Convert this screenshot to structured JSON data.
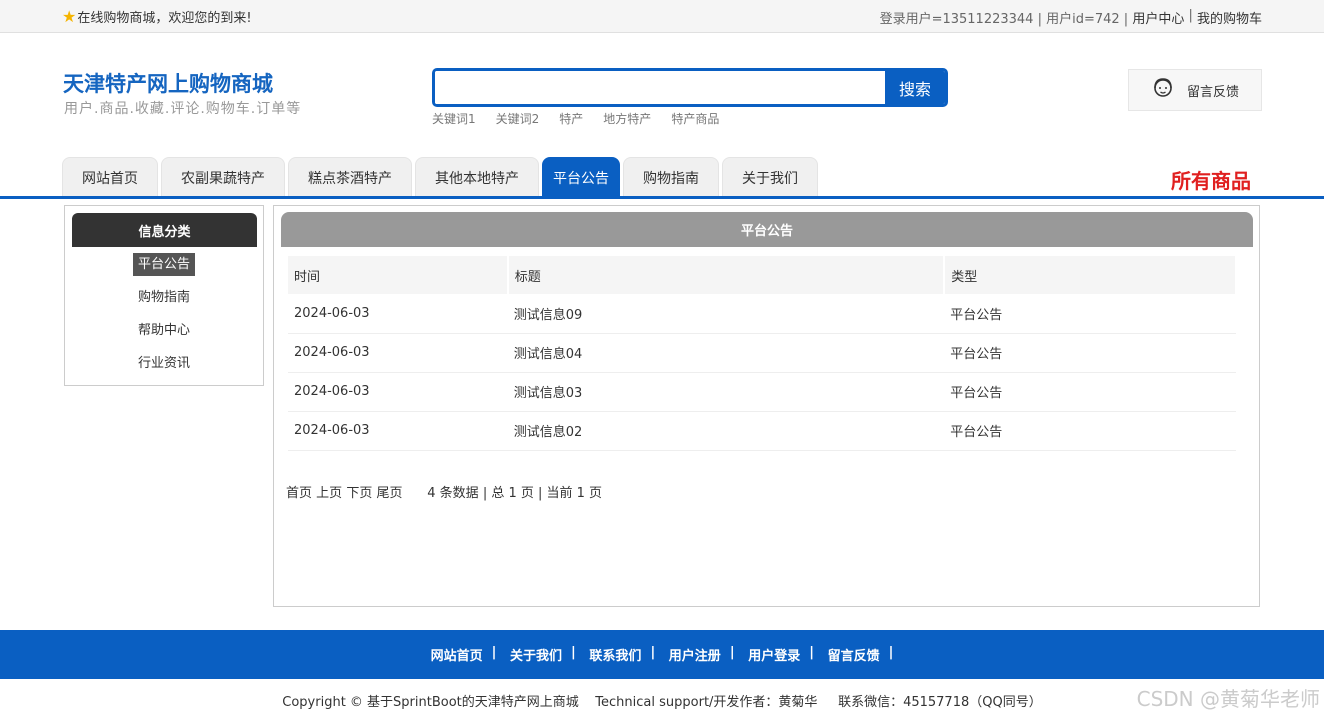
{
  "topbar": {
    "welcome": "在线购物商城，欢迎您的到来!",
    "user_info": "登录用户=13511223344 | 用户id=742 | ",
    "user_center": "用户中心",
    "sep": " | ",
    "cart": "我的购物车"
  },
  "header": {
    "title": "天津特产网上购物商城",
    "subtitle": "用户.商品.收藏.评论.购物车.订单等",
    "search_button": "搜索",
    "search_value": "",
    "hotwords": [
      "关键词1",
      "关键词2",
      "特产",
      "地方特产",
      "特产商品"
    ],
    "feedback": "留言反馈"
  },
  "nav": {
    "tabs": [
      "网站首页",
      "农副果蔬特产",
      "糕点茶酒特产",
      "其他本地特产",
      "平台公告",
      "购物指南",
      "关于我们"
    ],
    "active_index": 4,
    "all_goods": "所有商品"
  },
  "sidebar": {
    "title": "信息分类",
    "items": [
      "平台公告",
      "购物指南",
      "帮助中心",
      "行业资讯"
    ]
  },
  "main": {
    "title": "平台公告",
    "columns": [
      "时间",
      "标题",
      "类型"
    ],
    "rows": [
      [
        "2024-06-03",
        "测试信息09",
        "平台公告"
      ],
      [
        "2024-06-03",
        "测试信息04",
        "平台公告"
      ],
      [
        "2024-06-03",
        "测试信息03",
        "平台公告"
      ],
      [
        "2024-06-03",
        "测试信息02",
        "平台公告"
      ]
    ],
    "pager": {
      "first": "首页",
      "prev": "上页",
      "next": "下页",
      "last": "尾页",
      "summary": "4 条数据 | 总 1 页 | 当前 1 页"
    }
  },
  "footer": {
    "links": [
      "网站首页",
      "关于我们",
      "联系我们",
      "用户注册",
      "用户登录",
      "留言反馈"
    ],
    "copyright": "Copyright © 基于SprintBoot的天津特产网上商城    Technical support/开发作者：黄菊华     联系微信：45157718（QQ同号）"
  },
  "watermark": "CSDN @黄菊华老师",
  "colors": {
    "primary": "#0a5fc2",
    "accent_red": "#e02020"
  }
}
